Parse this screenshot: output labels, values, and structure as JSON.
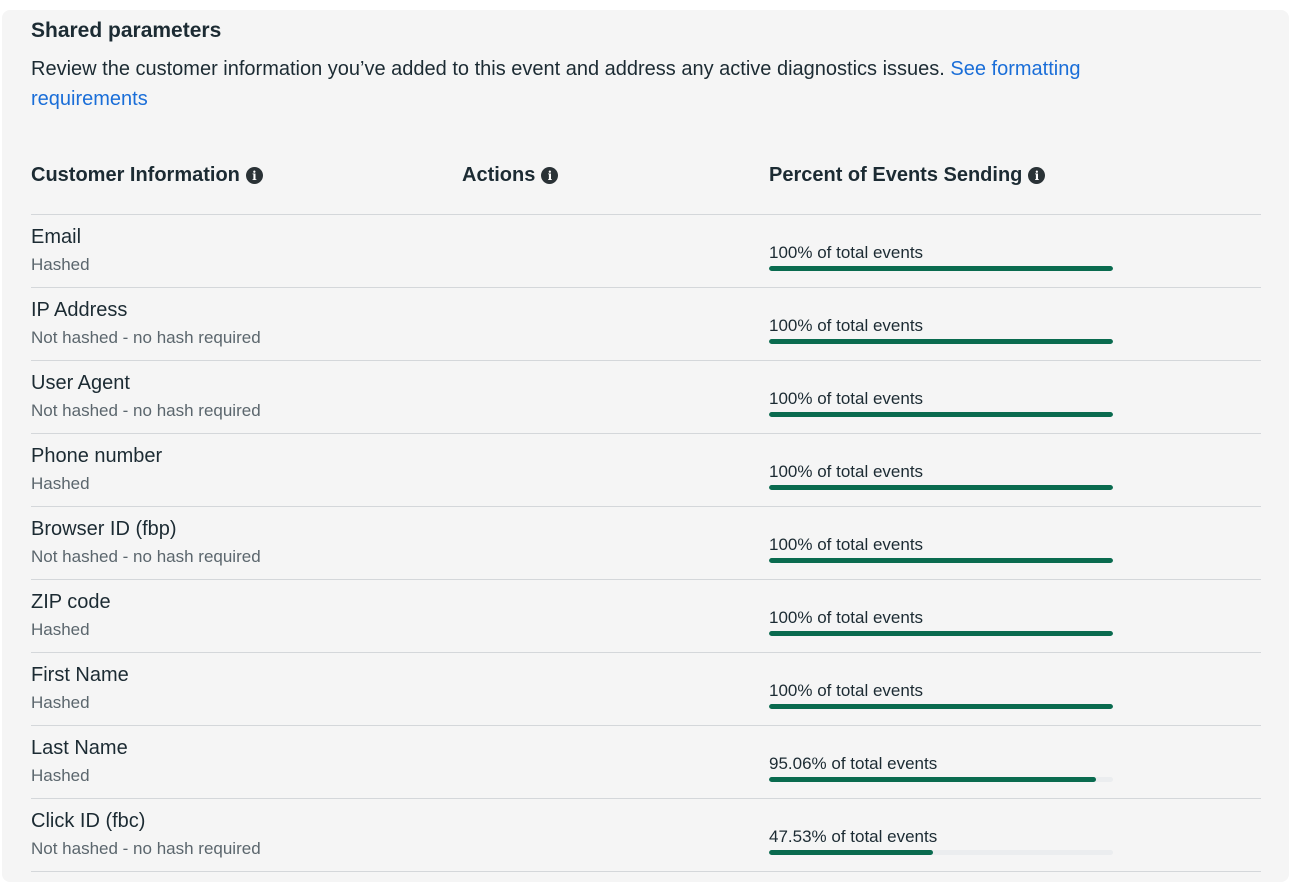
{
  "section": {
    "title": "Shared parameters",
    "description": "Review the customer information you’ve added to this event and address any active diagnostics issues. ",
    "link_text": "See formatting requirements"
  },
  "table": {
    "headers": {
      "customer_info": "Customer Information",
      "actions": "Actions",
      "percent": "Percent of Events Sending"
    },
    "info_icon": "info-icon",
    "accent_color": "#0a6b4f",
    "rows": [
      {
        "name": "Email",
        "hash": "Hashed",
        "percent_label": "100% of total events",
        "percent": 100
      },
      {
        "name": "IP Address",
        "hash": "Not hashed - no hash required",
        "percent_label": "100% of total events",
        "percent": 100
      },
      {
        "name": "User Agent",
        "hash": "Not hashed - no hash required",
        "percent_label": "100% of total events",
        "percent": 100
      },
      {
        "name": "Phone number",
        "hash": "Hashed",
        "percent_label": "100% of total events",
        "percent": 100
      },
      {
        "name": "Browser ID (fbp)",
        "hash": "Not hashed - no hash required",
        "percent_label": "100% of total events",
        "percent": 100
      },
      {
        "name": "ZIP code",
        "hash": "Hashed",
        "percent_label": "100% of total events",
        "percent": 100
      },
      {
        "name": "First Name",
        "hash": "Hashed",
        "percent_label": "100% of total events",
        "percent": 100
      },
      {
        "name": "Last Name",
        "hash": "Hashed",
        "percent_label": "95.06% of total events",
        "percent": 95.06
      },
      {
        "name": "Click ID (fbc)",
        "hash": "Not hashed - no hash required",
        "percent_label": "47.53% of total events",
        "percent": 47.53
      }
    ]
  }
}
